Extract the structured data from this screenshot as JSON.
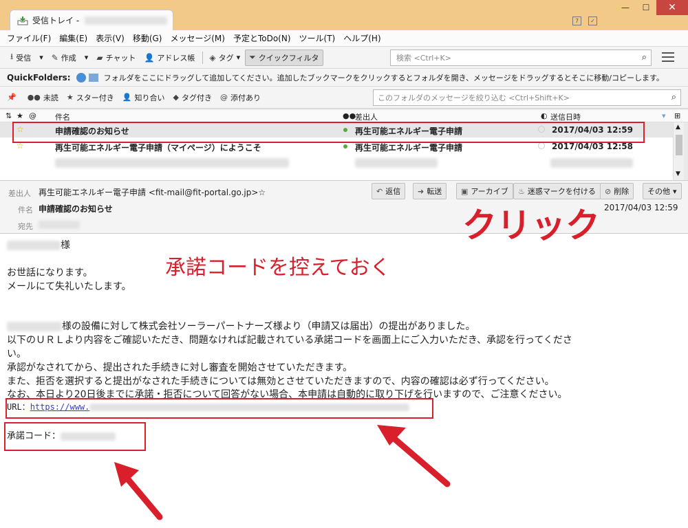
{
  "window": {
    "tab_title": "受信トレイ -",
    "minimize": "—",
    "maximize": "☐",
    "close": "✕"
  },
  "menu": [
    "ファイル(F)",
    "編集(E)",
    "表示(V)",
    "移動(G)",
    "メッセージ(M)",
    "予定とToDo(N)",
    "ツール(T)",
    "ヘルプ(H)"
  ],
  "toolbar": {
    "receive": "受信",
    "compose": "作成",
    "chat": "チャット",
    "addressbook": "アドレス帳",
    "tag": "タグ",
    "quickfilter": "クイックフィルタ",
    "search_placeholder": "検索 <Ctrl+K>"
  },
  "quickfolders": {
    "label": "QuickFolders:",
    "hint": "フォルダをここにドラッグして追加してください。追加したブックマークをクリックするとフォルダを開き、メッセージをドラッグするとそこに移動/コピーします。"
  },
  "filterbar": {
    "unread": "未読",
    "starred": "スター付き",
    "contacts": "知り合い",
    "tagged": "タグ付き",
    "attachment": "添付あり",
    "search_placeholder": "このフォルダのメッセージを絞り込む <Ctrl+Shift+K>"
  },
  "list": {
    "col_subject": "件名",
    "col_from": "差出人",
    "col_date": "送信日時",
    "rows": [
      {
        "subject": "申請確認のお知らせ",
        "from": "再生可能エネルギー電子申請",
        "date": "2017/04/03 12:59"
      },
      {
        "subject": "再生可能エネルギー電子申請（マイページ）にようこそ",
        "from": "再生可能エネルギー電子申請",
        "date": "2017/04/03 12:58"
      }
    ]
  },
  "message": {
    "from_label": "差出人",
    "from_value": "再生可能エネルギー電子申請 <fit-mail@fit-portal.go.jp>☆",
    "subject_label": "件名",
    "subject_value": "申請確認のお知らせ",
    "to_label": "宛先",
    "date": "2017/04/03 12:59",
    "actions": {
      "reply": "返信",
      "forward": "転送",
      "archive": "アーカイブ",
      "junk": "迷惑マークを付ける",
      "delete": "削除",
      "other": "その他"
    }
  },
  "body": {
    "salutation": "様",
    "l1": "お世話になります。",
    "l2": "メールにて失礼いたします。",
    "p1": "様の設備に対して株式会社ソーラーパートナーズ様より（申請又は届出）の提出がありました。",
    "p2": "以下のＵＲＬより内容をご確認いただき、問題なければ記載されている承諾コードを画面上にご入力いただき、承認を行ってくださ",
    "p2b": "い。",
    "p3": "承認がなされてから、提出された手続きに対し審査を開始させていただきます。",
    "p4": "また、拒否を選択すると提出がなされた手続きについては無効とさせていただきますので、内容の確認は必ず行ってください。",
    "p5": "なお、本日より20日後までに承諾・拒否について回答がない場合、本申請は自動的に取り下げを行いますので、ご注意ください。",
    "url_label": "URL：",
    "url_text": "https://www.",
    "code_label": "承諾コード："
  },
  "annotations": {
    "click": "クリック",
    "copy_code": "承諾コードを控えておく",
    "color": "#d81f2b"
  }
}
